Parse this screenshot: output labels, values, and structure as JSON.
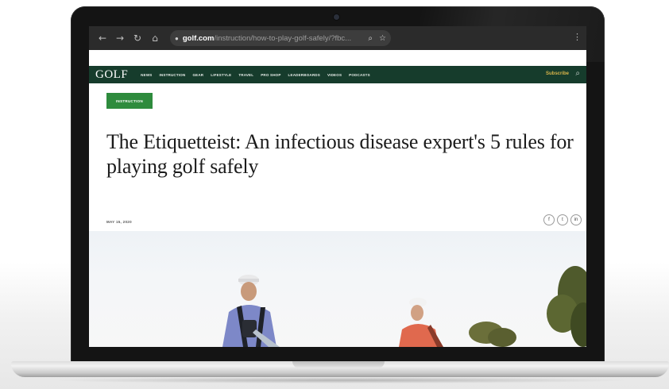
{
  "browser": {
    "url_domain": "golf.com",
    "url_path": "/instruction/how-to-play-golf-safely/?fbc...",
    "back_icon": "arrow-left-icon",
    "forward_icon": "arrow-right-icon",
    "reload_icon": "reload-icon",
    "home_icon": "home-icon"
  },
  "site": {
    "logo": "GOLF",
    "nav": [
      "NEWS",
      "INSTRUCTION",
      "GEAR",
      "LIFESTYLE",
      "TRAVEL",
      "PRO SHOP",
      "LEADERBOARDS",
      "VIDEOS",
      "PODCASTS"
    ],
    "subscribe": "Subscribe",
    "header_color": "#163c2c",
    "accent_color": "#d8b44a"
  },
  "article": {
    "category": "INSTRUCTION",
    "category_color": "#2e8b3d",
    "headline": "The Etiquetteist: An infectious disease expert's 5 rules for playing golf safely",
    "date": "MAY 15, 2020",
    "share_icons": [
      "f",
      "t",
      "in"
    ]
  }
}
